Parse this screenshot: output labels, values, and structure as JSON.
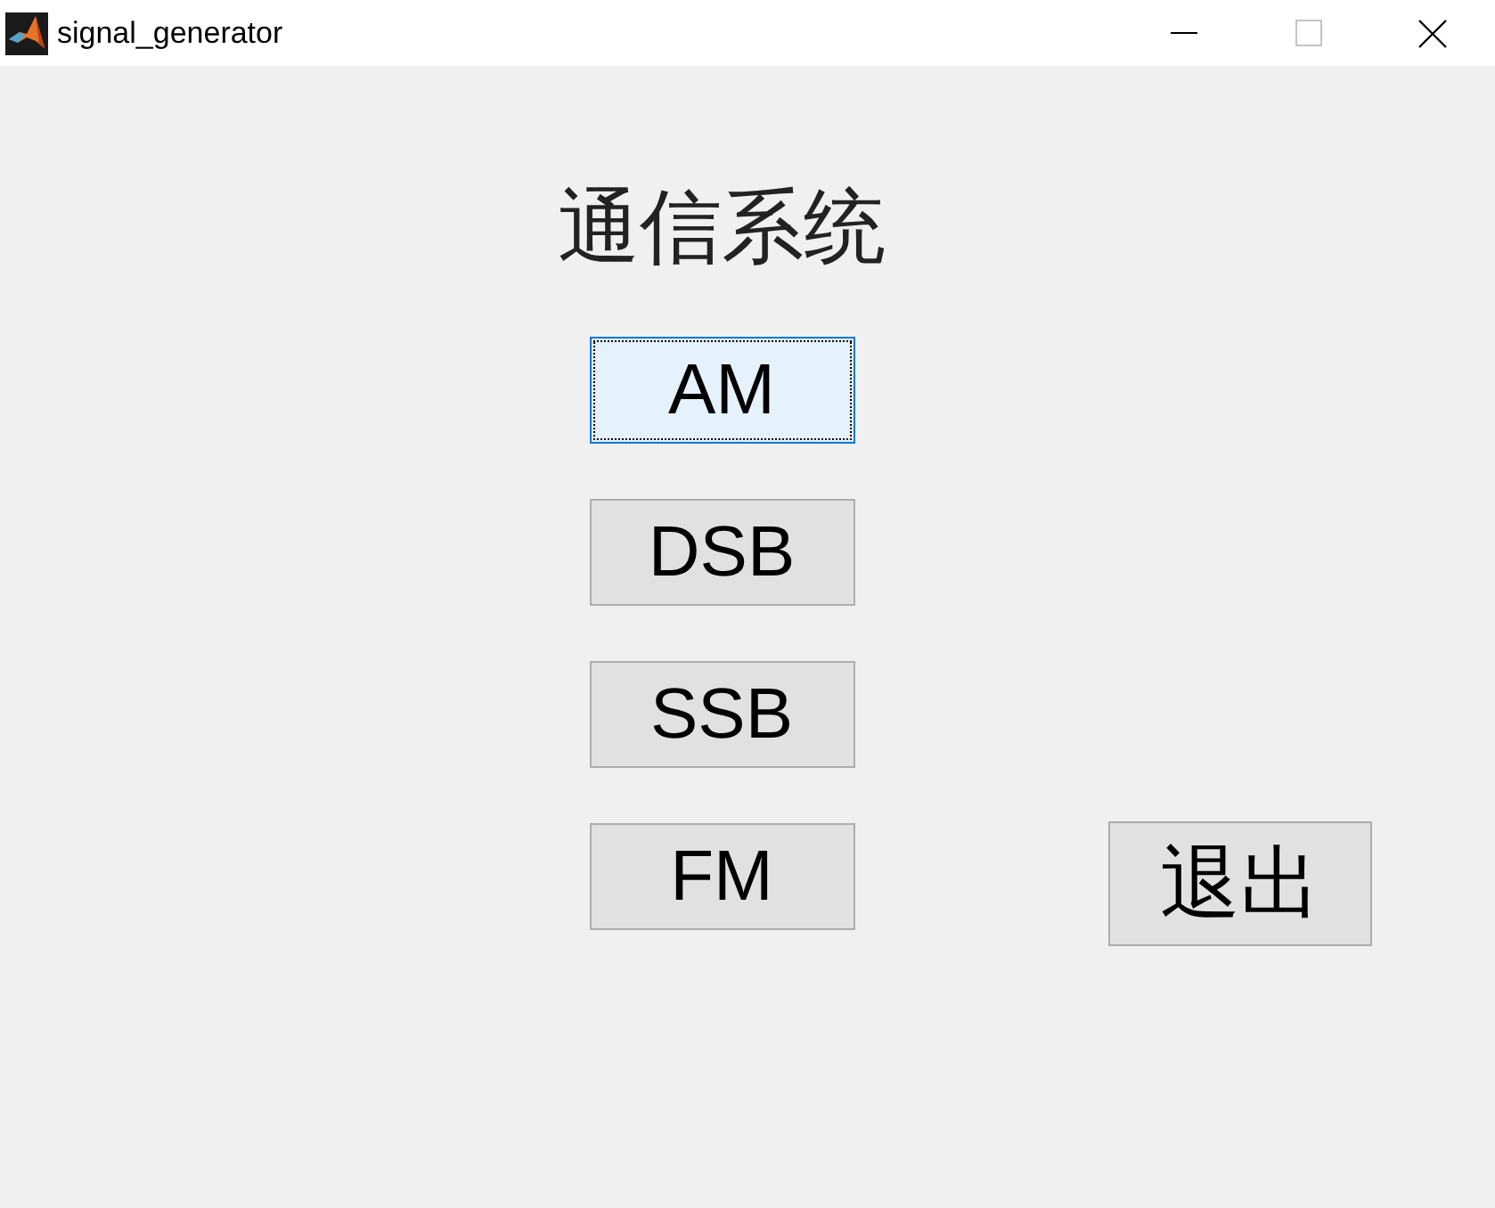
{
  "window": {
    "title": "signal_generator",
    "maximize_enabled": false
  },
  "heading": "通信系统",
  "buttons": [
    {
      "label": "AM",
      "focused": true
    },
    {
      "label": "DSB",
      "focused": false
    },
    {
      "label": "SSB",
      "focused": false
    },
    {
      "label": "FM",
      "focused": false
    }
  ],
  "exit_button": {
    "label": "退出",
    "focused": false
  }
}
